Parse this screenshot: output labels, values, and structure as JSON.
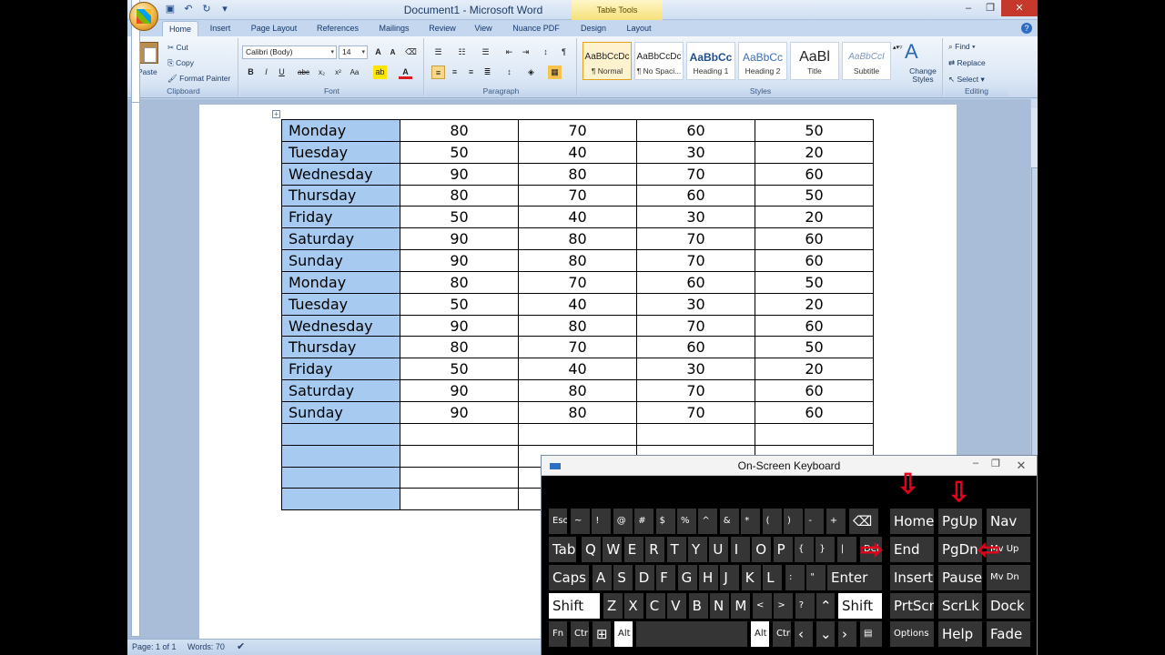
{
  "window": {
    "title": "Document1 - Microsoft Word",
    "context_tab": "Table Tools",
    "controls": {
      "minimize": "–",
      "restore": "❐",
      "close": "✕"
    }
  },
  "tabs": [
    "Home",
    "Insert",
    "Page Layout",
    "References",
    "Mailings",
    "Review",
    "View",
    "Nuance PDF",
    "Design",
    "Layout"
  ],
  "ribbon": {
    "clipboard": {
      "paste": "Paste",
      "cut": "Cut",
      "copy": "Copy",
      "format_painter": "Format Painter",
      "label": "Clipboard"
    },
    "font": {
      "name": "Calibri (Body)",
      "size": "14",
      "label": "Font"
    },
    "paragraph": {
      "label": "Paragraph"
    },
    "styles": {
      "items": [
        {
          "sample": "AaBbCcDc",
          "name": "¶ Normal"
        },
        {
          "sample": "AaBbCcDc",
          "name": "¶ No Spaci..."
        },
        {
          "sample": "AaBbCc",
          "name": "Heading 1"
        },
        {
          "sample": "AaBbCc",
          "name": "Heading 2"
        },
        {
          "sample": "AaBl",
          "name": "Title"
        },
        {
          "sample": "AaBbCcI",
          "name": "Subtitle"
        }
      ],
      "change_styles": "Change Styles",
      "label": "Styles"
    },
    "editing": {
      "find": "Find",
      "replace": "Replace",
      "select": "Select",
      "label": "Editing"
    }
  },
  "table": {
    "rows": [
      [
        "Monday",
        "80",
        "70",
        "60",
        "50"
      ],
      [
        "Tuesday",
        "50",
        "40",
        "30",
        "20"
      ],
      [
        "Wednesday",
        "90",
        "80",
        "70",
        "60"
      ],
      [
        "Thursday",
        "80",
        "70",
        "60",
        "50"
      ],
      [
        "Friday",
        "50",
        "40",
        "30",
        "20"
      ],
      [
        "Saturday",
        "90",
        "80",
        "70",
        "60"
      ],
      [
        "Sunday",
        "90",
        "80",
        "70",
        "60"
      ],
      [
        "Monday",
        "80",
        "70",
        "60",
        "50"
      ],
      [
        "Tuesday",
        "50",
        "40",
        "30",
        "20"
      ],
      [
        "Wednesday",
        "90",
        "80",
        "70",
        "60"
      ],
      [
        "Thursday",
        "80",
        "70",
        "60",
        "50"
      ],
      [
        "Friday",
        "50",
        "40",
        "30",
        "20"
      ],
      [
        "Saturday",
        "90",
        "80",
        "70",
        "60"
      ],
      [
        "Sunday",
        "90",
        "80",
        "70",
        "60"
      ],
      [
        "",
        "",
        "",
        "",
        ""
      ],
      [
        "",
        "",
        "",
        "",
        ""
      ],
      [
        "",
        "",
        "",
        "",
        ""
      ],
      [
        "",
        "",
        "",
        "",
        ""
      ]
    ]
  },
  "status": {
    "page": "Page: 1 of 1",
    "words": "Words: 70"
  },
  "osk": {
    "title": "On-Screen Keyboard",
    "keys": {
      "esc": "Esc",
      "tab": "Tab",
      "caps": "Caps",
      "shift": "Shift",
      "fn": "Fn",
      "ctrl": "Ctrl",
      "alt": "Alt",
      "enter": "Enter",
      "home": "Home",
      "pgup": "PgUp",
      "nav": "Nav",
      "end": "End",
      "pgdn": "PgDn",
      "mvup": "Mv Up",
      "insert": "Insert",
      "pause": "Pause",
      "mvdn": "Mv Dn",
      "prtscn": "PrtScn",
      "scrlk": "ScrLk",
      "dock": "Dock",
      "options": "Options",
      "help": "Help",
      "fade": "Fade",
      "del": "Del"
    },
    "row2": [
      "Q",
      "W",
      "E",
      "R",
      "T",
      "Y",
      "U",
      "I",
      "O",
      "P"
    ],
    "row3": [
      "A",
      "S",
      "D",
      "F",
      "G",
      "H",
      "J",
      "K",
      "L"
    ],
    "row4": [
      "Z",
      "X",
      "C",
      "V",
      "B",
      "N",
      "M"
    ]
  }
}
